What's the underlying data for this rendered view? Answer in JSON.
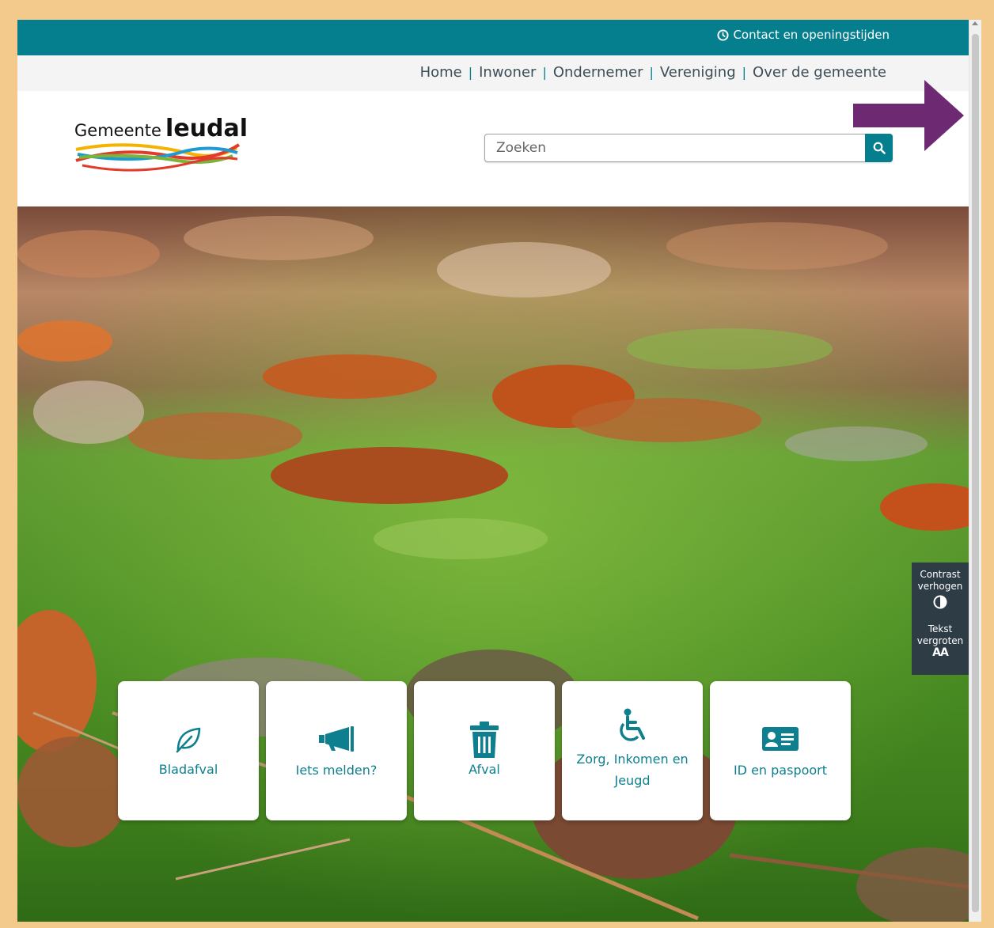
{
  "topbar": {
    "contact_label": "Contact en openingstijden"
  },
  "nav": {
    "items": [
      "Home",
      "Inwoner",
      "Ondernemer",
      "Vereniging",
      "Over de gemeente"
    ]
  },
  "logo": {
    "prefix": "Gemeente",
    "name": "leudal"
  },
  "search": {
    "placeholder": "Zoeken"
  },
  "accessibility": {
    "contrast_label_1": "Contrast",
    "contrast_label_2": "verhogen",
    "text_label_1": "Tekst",
    "text_label_2": "vergroten",
    "text_icon": "AA"
  },
  "tiles": [
    {
      "label": "Bladafval",
      "icon": "leaf-icon"
    },
    {
      "label": "Iets melden?",
      "icon": "megaphone-icon"
    },
    {
      "label": "Afval",
      "icon": "trash-icon"
    },
    {
      "label": "Zorg, Inkomen en Jeugd",
      "icon": "wheelchair-icon"
    },
    {
      "label": "ID en paspoort",
      "icon": "id-card-icon"
    }
  ],
  "colors": {
    "brand_teal": "#057e8e",
    "frame_border": "#f3c98c",
    "arrow": "#6d2a73",
    "panel_dark": "#2e3c46"
  }
}
